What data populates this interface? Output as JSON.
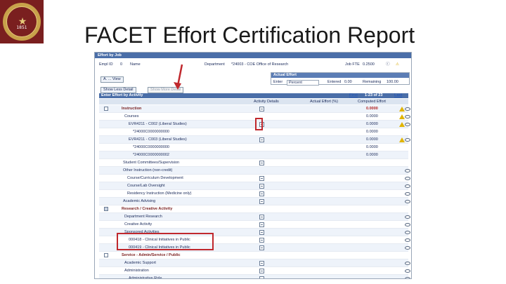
{
  "slide": {
    "title": "FACET Effort Certification Report",
    "seal_year": "1851"
  },
  "screen": {
    "window_title": "Effort by Job",
    "info": {
      "emplid_label": "Empl ID",
      "emplid_value": "0",
      "name_label": "Name",
      "job_label": "Department",
      "department": "*24003 - COE Office of Research",
      "job_fte_label": "Job FTE",
      "job_fte_value": "0.2500"
    },
    "buttons": {
      "fill_view": "A. ... View",
      "show_less": "Show Less Detail",
      "show_more": "Show More Detail"
    },
    "actual_effort": {
      "header": "Actual Effort",
      "enter_label": "Enter",
      "enter_value": "Percent",
      "entered_label": "Entered",
      "entered_value": "0.00",
      "remaining_label": "Remaining",
      "remaining_value": "100.00"
    },
    "grid": {
      "title": "Enter Effort by Activity",
      "pager_first": "First",
      "pager_range": "1-23 of 23",
      "pager_last": "Last",
      "columns": {
        "activity": "Activity Details",
        "actual": "Actual Effort (%)",
        "computed": "Computed Effort"
      },
      "rows": [
        {
          "label": "Instruction",
          "value": "0.0000"
        },
        {
          "label": "Courses",
          "value": "0.0000"
        },
        {
          "label": "EVR4211 - C002 (Liberal Studies)",
          "value": "0.0000"
        },
        {
          "label": "*24000C0000000000",
          "value": "0.0000"
        },
        {
          "label": "EVR4211 - C003 (Liberal Studies)",
          "value": "0.0000"
        },
        {
          "label": "*24000C0000000000",
          "value": "0.0000"
        },
        {
          "label": "*24000C0000000002",
          "value": "0.0000"
        },
        {
          "label": "Student Committees/Supervision",
          "value": ""
        },
        {
          "label": "Other Instruction (non-credit)",
          "value": ""
        },
        {
          "label": "Course/Curriculum Development",
          "value": ""
        },
        {
          "label": "Course/Lab Oversight",
          "value": ""
        },
        {
          "label": "Residency Instruction (Medicine only)",
          "value": ""
        },
        {
          "label": "Academic Advising",
          "value": ""
        },
        {
          "label": "Research / Creative Activity",
          "value": ""
        },
        {
          "label": "Department Research",
          "value": ""
        },
        {
          "label": "Creative Activity",
          "value": ""
        },
        {
          "label": "Sponsored Activities",
          "value": ""
        },
        {
          "label": "000418 - Clinical Initiatives in Public",
          "value": ""
        },
        {
          "label": "000419 - Clinical Initiatives in Public",
          "value": ""
        },
        {
          "label": "Service - Admin/Service / Public",
          "value": ""
        },
        {
          "label": "Academic Support",
          "value": ""
        },
        {
          "label": "Administration",
          "value": ""
        },
        {
          "label": "Administrative Role",
          "value": ""
        }
      ]
    }
  },
  "colors": {
    "highlight": "#c0282d",
    "header_blue": "#4a6ea8",
    "warning": "#e0b400"
  }
}
